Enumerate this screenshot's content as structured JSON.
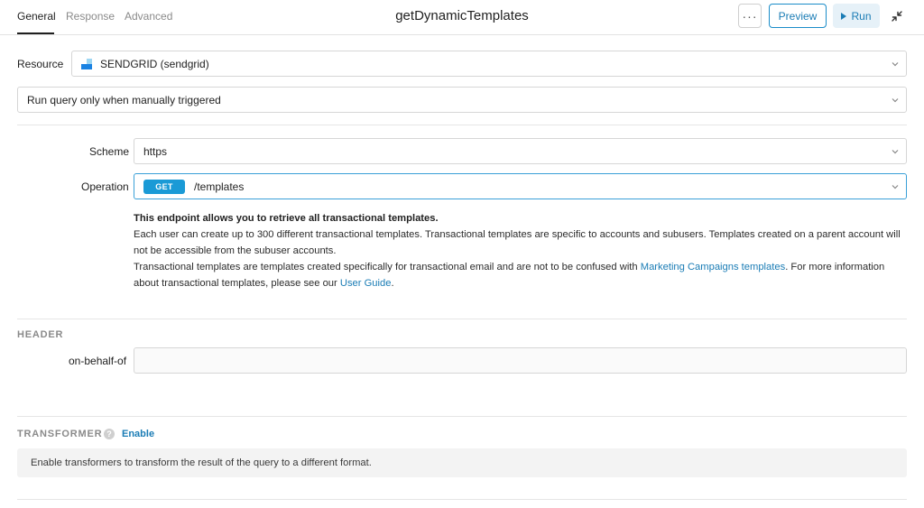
{
  "tabs": [
    {
      "label": "General",
      "active": true
    },
    {
      "label": "Response",
      "active": false
    },
    {
      "label": "Advanced",
      "active": false
    }
  ],
  "query": {
    "name": "getDynamicTemplates"
  },
  "toolbar": {
    "more_label": "···",
    "preview_label": "Preview",
    "run_label": "Run",
    "collapse_icon": "collapse-arrows-icon"
  },
  "resource": {
    "label": "Resource",
    "value": "SENDGRID (sendgrid)",
    "icon": "sendgrid-logo"
  },
  "trigger": {
    "value": "Run query only when manually triggered"
  },
  "scheme": {
    "label": "Scheme",
    "value": "https"
  },
  "operation": {
    "label": "Operation",
    "method": "GET",
    "path": "/templates"
  },
  "description": {
    "heading": "This endpoint allows you to retrieve all transactional templates.",
    "para1": "Each user can create up to 300 different transactional templates. Transactional templates are specific to accounts and subusers. Templates created on a parent account will not be accessible from the subuser accounts.",
    "para2_start": "Transactional templates are templates created specifically for transactional email and are not to be confused with ",
    "link1": "Marketing Campaigns templates",
    "para2_mid": ". For more information about transactional templates, please see our ",
    "link2": "User Guide",
    "para2_end": "."
  },
  "header_section": {
    "title": "HEADER",
    "field_label": "on-behalf-of",
    "field_value": ""
  },
  "transformer": {
    "title": "TRANSFORMER",
    "help": "?",
    "enable_label": "Enable",
    "info": "Enable transformers to transform the result of the query to a different format."
  },
  "colors": {
    "accent": "#1a7cb5",
    "badge": "#1a9ad6",
    "sendgrid_light": "#9dd6f3",
    "sendgrid_dark": "#1a82e2"
  }
}
